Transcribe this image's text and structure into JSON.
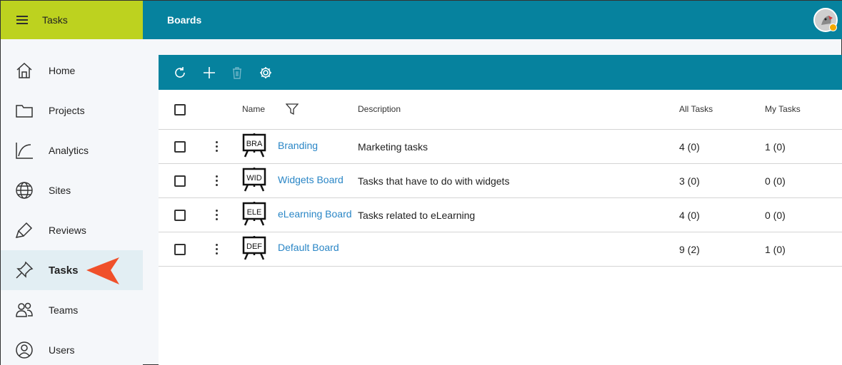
{
  "app": {
    "title": "Tasks",
    "page_title": "Boards"
  },
  "sidebar": {
    "items": [
      {
        "label": "Home",
        "icon": "home-icon"
      },
      {
        "label": "Projects",
        "icon": "folder-icon"
      },
      {
        "label": "Analytics",
        "icon": "analytics-icon"
      },
      {
        "label": "Sites",
        "icon": "globe-icon"
      },
      {
        "label": "Reviews",
        "icon": "highlighter-icon"
      },
      {
        "label": "Tasks",
        "icon": "pin-icon",
        "active": true
      },
      {
        "label": "Teams",
        "icon": "people-icon"
      },
      {
        "label": "Users",
        "icon": "user-icon"
      }
    ]
  },
  "toolbar": {
    "actions": [
      "refresh-icon",
      "add-icon",
      "delete-icon",
      "settings-icon"
    ]
  },
  "table": {
    "columns": {
      "name": "Name",
      "description": "Description",
      "all_tasks": "All Tasks",
      "my_tasks": "My Tasks"
    },
    "rows": [
      {
        "code": "BRA",
        "name": "Branding",
        "description": "Marketing tasks",
        "all_tasks": "4 (0)",
        "my_tasks": "1 (0)"
      },
      {
        "code": "WID",
        "name": "Widgets Board",
        "description": "Tasks that have to do with widgets",
        "all_tasks": "3 (0)",
        "my_tasks": "0 (0)"
      },
      {
        "code": "ELE",
        "name": "eLearning Board",
        "description": "Tasks related to eLearning",
        "all_tasks": "4 (0)",
        "my_tasks": "0 (0)"
      },
      {
        "code": "DEF",
        "name": "Default Board",
        "description": "",
        "all_tasks": "9 (2)",
        "my_tasks": "1 (0)"
      }
    ]
  },
  "colors": {
    "header": "#06829e",
    "brand": "#bdd21f",
    "link": "#2a86c6",
    "pointer": "#f0502a",
    "active_nav": "#e2eef3"
  }
}
